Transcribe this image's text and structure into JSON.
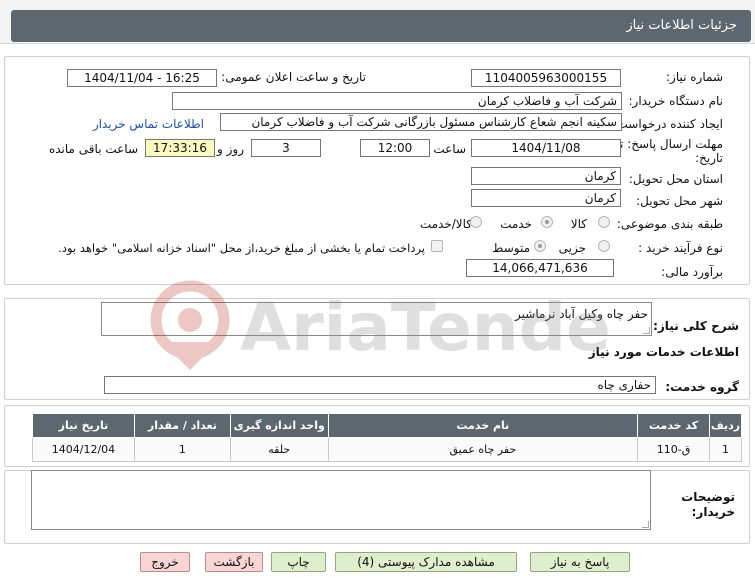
{
  "header": {
    "title": "جزئیات اطلاعات نیاز"
  },
  "need_info": {
    "need_number_label": "شماره نیاز:",
    "need_number": "1104005963000155",
    "announce_label": "تاریخ و ساعت اعلان عمومی:",
    "announce_value": "1404/11/04 - 16:25",
    "buyer_org_label": "نام دستگاه خریدار:",
    "buyer_org": "شرکت آب و فاضلاب کرمان",
    "requester_label": "ایجاد کننده درخواست:",
    "requester": "سکینه انجم شعاع کارشناس مسئول بازرگانی شرکت آب و فاضلاب کرمان",
    "contact_link": "اطلاعات تماس خریدار",
    "deadline_label_1": "مهلت ارسال پاسخ: تا",
    "deadline_label_2": "تاریخ:",
    "deadline_date": "1404/11/08",
    "time_label": "ساعت",
    "deadline_time": "12:00",
    "days_value": "3",
    "days_label": "روز و",
    "remaining_time": "17:33:16",
    "remaining_label": "ساعت باقی مانده",
    "province_label": "استان محل تحویل:",
    "province": "کرمان",
    "city_label": "شهر محل تحویل:",
    "city": "کرمان",
    "category_label": "طبقه بندی موضوعی:",
    "category_options": [
      "کالا",
      "خدمت",
      "کالا/خدمت"
    ],
    "category_selected": "خدمت",
    "process_label": "نوع فرآیند خرید :",
    "process_options": [
      "جزیی",
      "متوسط"
    ],
    "process_selected": "متوسط",
    "treasury_note": "پرداخت تمام یا بخشی از مبلغ خرید،از محل \"اسناد خزانه اسلامی\" خواهد بود.",
    "budget_label": "برآورد مالی:",
    "budget": "14,066,471,636"
  },
  "description": {
    "label": "شرح کلی نیاز:",
    "text": "حفر چاه وکیل آباد نرماشیر"
  },
  "services": {
    "section_title": "اطلاعات خدمات مورد نیاز",
    "group_label": "گروه خدمت:",
    "group_value": "حفاری چاه",
    "table": {
      "headers": [
        "ردیف",
        "کد خدمت",
        "نام خدمت",
        "واحد اندازه گیری",
        "تعداد / مقدار",
        "تاریخ نیاز"
      ],
      "rows": [
        [
          "1",
          "ق-110",
          "حفر چاه عمیق",
          "حلقه",
          "1",
          "1404/12/04"
        ]
      ]
    }
  },
  "buyer_notes": {
    "label_1": "توضیحات",
    "label_2": "خریدار:",
    "text": ""
  },
  "buttons": {
    "reply": "پاسخ به نیاز",
    "view_docs": "مشاهده مدارک پیوستی (4)",
    "print": "چاپ",
    "back": "بازگشت",
    "exit": "خروج"
  },
  "watermark": {
    "text": "AriaTender.neT"
  }
}
